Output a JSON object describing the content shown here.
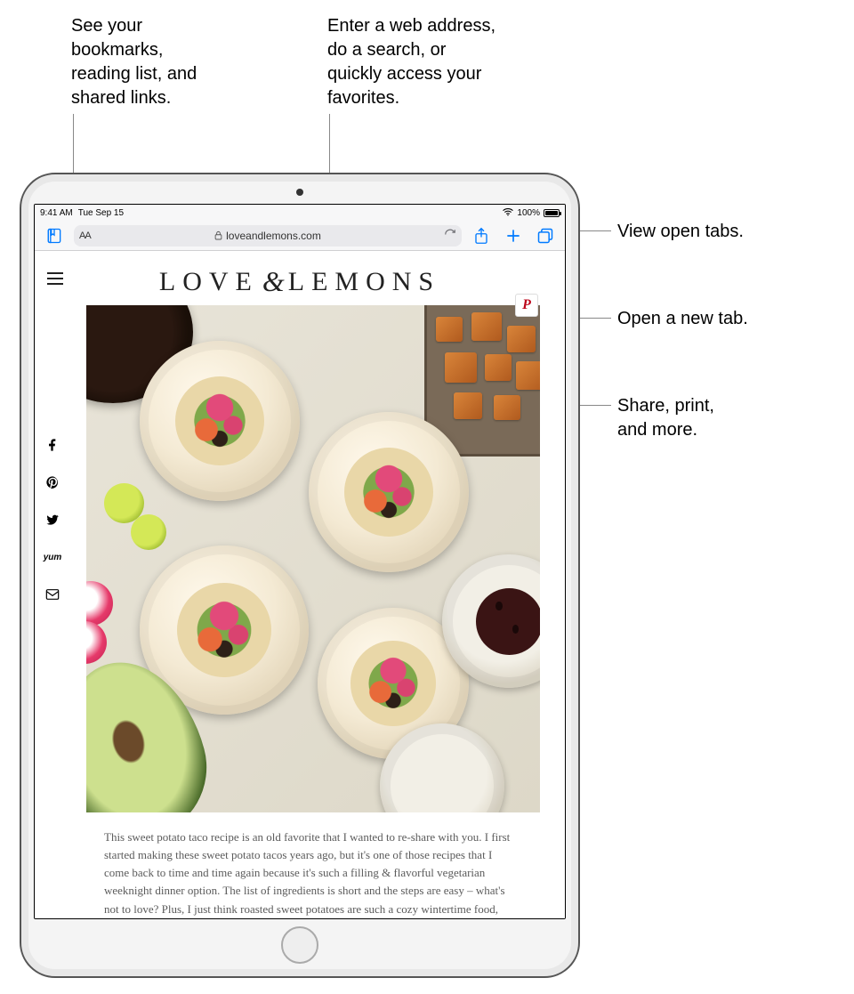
{
  "callouts": {
    "bookmarks": "See your\nbookmarks,\nreading list, and\nshared links.",
    "search": "Enter a web address,\ndo a search, or\nquickly access your\nfavorites.",
    "tabs": "View open tabs.",
    "newtab": "Open a new tab.",
    "share": "Share, print,\nand more."
  },
  "statusbar": {
    "time": "9:41 AM",
    "date": "Tue Sep 15",
    "battery_pct": "100%"
  },
  "toolbar": {
    "url": "loveandlemons.com"
  },
  "page": {
    "logo_1": "LOVE",
    "logo_amp": "&",
    "logo_2": "LEMONS",
    "pin_label": "P",
    "article": "This sweet potato taco recipe is an old favorite that I wanted to re-share with you. I first started making these sweet potato tacos years ago, but it's one of those recipes that I come back to time and time again because it's such a filling & flavorful vegetarian weeknight dinner option. The list of ingredients is short and the steps are easy – what's not to love? Plus, I just think roasted sweet potatoes are such a cozy wintertime food, especially when they're wrapped up into warm tortillas like a big hug."
  }
}
